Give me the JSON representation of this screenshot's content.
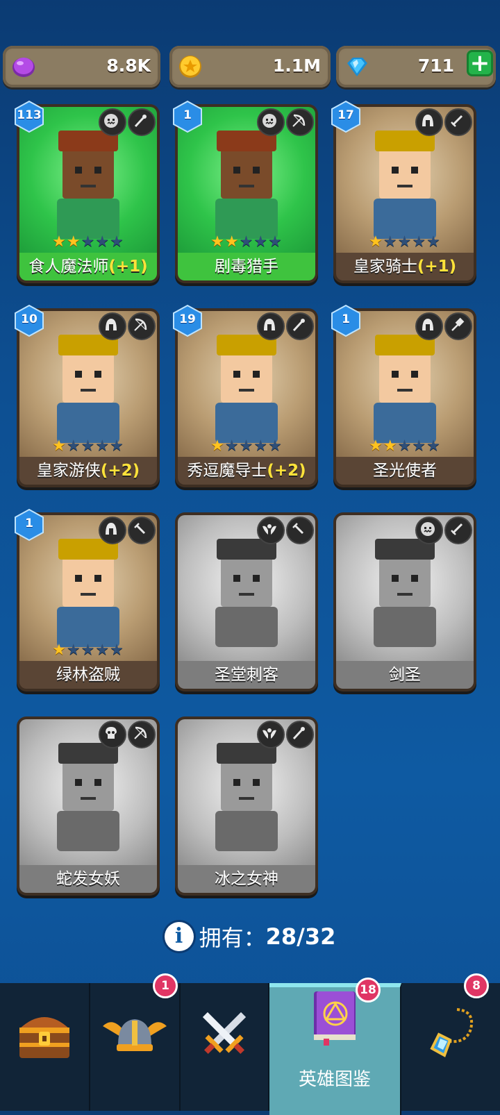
{
  "currencies": {
    "elixir": "8.8K",
    "coins": "1.1M",
    "gems": "711"
  },
  "heroes": [
    {
      "name": "食人魔法师",
      "bonus": "(+1)",
      "level": "113",
      "stars": 2,
      "art": "green",
      "owned": true,
      "class_icon": "ogre-icon",
      "weapon_icon": "staff-icon"
    },
    {
      "name": "剧毒猎手",
      "bonus": "",
      "level": "1",
      "stars": 2,
      "art": "green",
      "owned": true,
      "class_icon": "ogre-icon",
      "weapon_icon": "bow-icon"
    },
    {
      "name": "皇家骑士",
      "bonus": "(+1)",
      "level": "17",
      "stars": 1,
      "art": "tan",
      "owned": true,
      "class_icon": "helmet-icon",
      "weapon_icon": "sword-icon"
    },
    {
      "name": "皇家游侠",
      "bonus": "(+2)",
      "level": "10",
      "stars": 1,
      "art": "tan",
      "owned": true,
      "class_icon": "helmet-icon",
      "weapon_icon": "bow-icon"
    },
    {
      "name": "秀逗魔导士",
      "bonus": "(+2)",
      "level": "19",
      "stars": 1,
      "art": "tan",
      "owned": true,
      "class_icon": "helmet-icon",
      "weapon_icon": "staff-icon"
    },
    {
      "name": "圣光使者",
      "bonus": "",
      "level": "1",
      "stars": 2,
      "art": "tan",
      "owned": true,
      "class_icon": "helmet-icon",
      "weapon_icon": "hammer-icon"
    },
    {
      "name": "绿林盗贼",
      "bonus": "",
      "level": "1",
      "stars": 1,
      "art": "tan",
      "owned": true,
      "class_icon": "helmet-icon",
      "weapon_icon": "dagger-icon"
    },
    {
      "name": "圣堂刺客",
      "bonus": "",
      "level": "",
      "stars": 0,
      "art": "gray",
      "owned": false,
      "class_icon": "winged-icon",
      "weapon_icon": "dagger-icon"
    },
    {
      "name": "剑圣",
      "bonus": "",
      "level": "",
      "stars": 0,
      "art": "gray",
      "owned": false,
      "class_icon": "ogre-icon",
      "weapon_icon": "sword-icon"
    },
    {
      "name": "蛇发女妖",
      "bonus": "",
      "level": "",
      "stars": 0,
      "art": "gray",
      "owned": false,
      "class_icon": "skull-icon",
      "weapon_icon": "bow-icon"
    },
    {
      "name": "冰之女神",
      "bonus": "",
      "level": "",
      "stars": 0,
      "art": "gray",
      "owned": false,
      "class_icon": "winged-icon",
      "weapon_icon": "staff-icon"
    }
  ],
  "collection": {
    "label": "拥有：",
    "count": "28/32"
  },
  "nav": {
    "tabs": [
      {
        "name": "chest-tab",
        "icon": "chest-icon",
        "badge": ""
      },
      {
        "name": "heroes-tab",
        "icon": "winged-helmet-icon",
        "badge": "1"
      },
      {
        "name": "battle-tab",
        "icon": "crossed-swords-icon",
        "badge": ""
      },
      {
        "name": "codex-tab",
        "icon": "spellbook-icon",
        "badge": "18",
        "label": "英雄图鉴"
      },
      {
        "name": "amulet-tab",
        "icon": "amulet-icon",
        "badge": "8"
      }
    ]
  }
}
